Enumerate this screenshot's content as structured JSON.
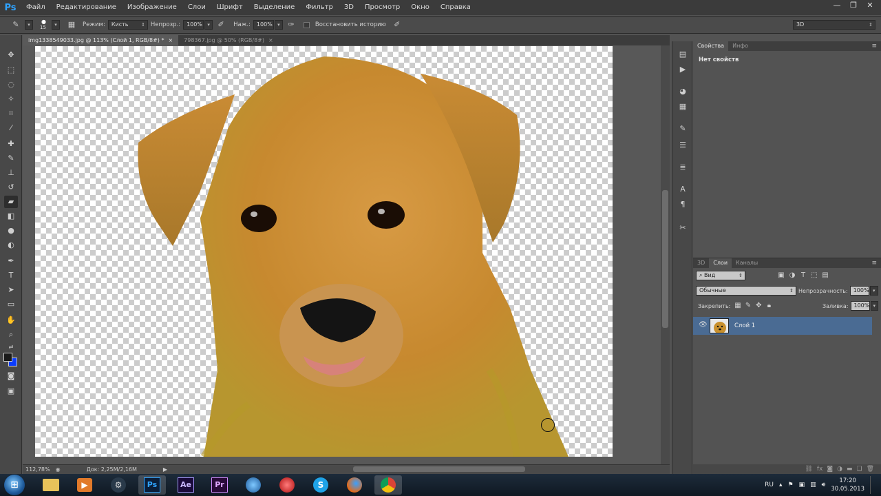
{
  "app": {
    "logo": "Ps"
  },
  "menu": [
    "Файл",
    "Редактирование",
    "Изображение",
    "Слои",
    "Шрифт",
    "Выделение",
    "Фильтр",
    "3D",
    "Просмотр",
    "Окно",
    "Справка"
  ],
  "window_controls": {
    "minimize": "—",
    "restore": "❐",
    "close": "✕"
  },
  "options": {
    "brush_size": "15",
    "mode_label": "Режим:",
    "mode_value": "Кисть",
    "opacity_label": "Непрозр.:",
    "opacity_value": "100%",
    "pressure_label": "Наж.:",
    "pressure_value": "100%",
    "history_label": "Восстановить историю",
    "workspace": "3D"
  },
  "tabs": [
    {
      "label": "img1338549033.jpg @ 113% (Слой 1, RGB/8#) *",
      "close": "×"
    },
    {
      "label": "798367.jpg @ 50% (RGB/8#)",
      "close": "×"
    }
  ],
  "status": {
    "zoom": "112,78%",
    "doc_info": "Док: 2,25M/2,16M"
  },
  "properties": {
    "tab_props": "Свойства",
    "tab_info": "Инфо",
    "content": "Нет свойств"
  },
  "layers": {
    "tab_3d": "3D",
    "tab_layers": "Слои",
    "tab_channels": "Каналы",
    "filter_label": "Вид",
    "blend_mode": "Обычные",
    "opacity_label": "Непрозрачность:",
    "opacity_value": "100%",
    "lock_label": "Закрепить:",
    "fill_label": "Заливка:",
    "fill_value": "100%",
    "layer_name": "Слой 1"
  },
  "taskbar": {
    "apps": [
      "Ps",
      "Ae",
      "Pr"
    ],
    "lang": "RU",
    "time": "17:20",
    "date": "30.05.2013"
  },
  "colors": {
    "foreground": "#1a1a1a",
    "background": "#0a3cff",
    "accent": "#4a6b93"
  },
  "icons": [
    "move-icon",
    "marquee-icon",
    "lasso-icon",
    "quick-selection-icon",
    "crop-icon",
    "eyedropper-icon",
    "healing-brush-icon",
    "brush-icon",
    "clone-stamp-icon",
    "history-brush-icon",
    "eraser-icon",
    "gradient-icon",
    "blur-icon",
    "dodge-icon",
    "pen-icon",
    "type-icon",
    "path-selection-icon",
    "shape-icon",
    "hand-icon",
    "zoom-icon"
  ]
}
